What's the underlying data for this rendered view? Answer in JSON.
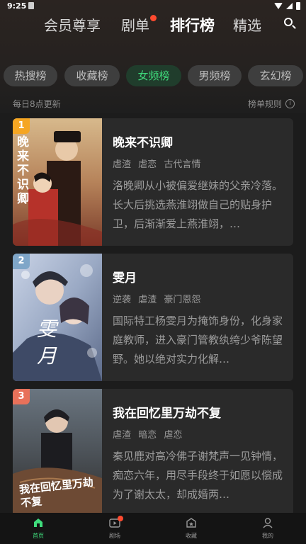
{
  "status": {
    "time": "9:25"
  },
  "top_tabs": [
    {
      "label": "会员尊享",
      "active": false
    },
    {
      "label": "剧单",
      "active": false,
      "badge": true
    },
    {
      "label": "排行榜",
      "active": true
    },
    {
      "label": "精选",
      "active": false
    }
  ],
  "chips": [
    {
      "label": "热搜榜",
      "active": false
    },
    {
      "label": "收藏榜",
      "active": false
    },
    {
      "label": "女频榜",
      "active": true
    },
    {
      "label": "男频榜",
      "active": false
    },
    {
      "label": "玄幻榜",
      "active": false
    }
  ],
  "subheader": {
    "update_text": "每日8点更新",
    "rules_text": "榜单规则"
  },
  "ranking": [
    {
      "rank": "1",
      "title": "晚来不识卿",
      "tags": [
        "虐渣",
        "虐恋",
        "古代言情"
      ],
      "description": "洛晚卿从小被偏爱继妹的父亲冷落。长大后挑选燕淮翊做自己的贴身护卫，后渐渐爱上燕淮翊，…",
      "poster_text": "晚来不识卿",
      "badge_color": "#f5a623"
    },
    {
      "rank": "2",
      "title": "雯月",
      "tags": [
        "逆袭",
        "虐渣",
        "豪门恩怨"
      ],
      "description": "国际特工杨雯月为掩饰身份，化身家庭教师，进入豪门管教纨绔少爷陈望野。她以绝对实力化解…",
      "poster_text": "雯月",
      "badge_color": "#7fa6c8"
    },
    {
      "rank": "3",
      "title": "我在回忆里万劫不复",
      "tags": [
        "虐渣",
        "暗恋",
        "虐恋"
      ],
      "description": "秦见鹿对高冷佛子谢梵声一见钟情，痴恋六年，用尽手段终于如愿以偿成为了谢太太，却成婚两…",
      "poster_text": "我在回忆里万劫不复",
      "badge_color": "#e8715a"
    }
  ],
  "bottom_nav": [
    {
      "label": "首页",
      "icon": "home-icon",
      "active": true
    },
    {
      "label": "剧场",
      "icon": "theater-icon",
      "active": false,
      "badge": true
    },
    {
      "label": "收藏",
      "icon": "bookmark-icon",
      "active": false
    },
    {
      "label": "我的",
      "icon": "profile-icon",
      "active": false
    }
  ],
  "colors": {
    "accent": "#3fdb7c",
    "badge_red": "#ff4a2f",
    "background": "#1c1c1c",
    "card": "#2a2a2a"
  }
}
